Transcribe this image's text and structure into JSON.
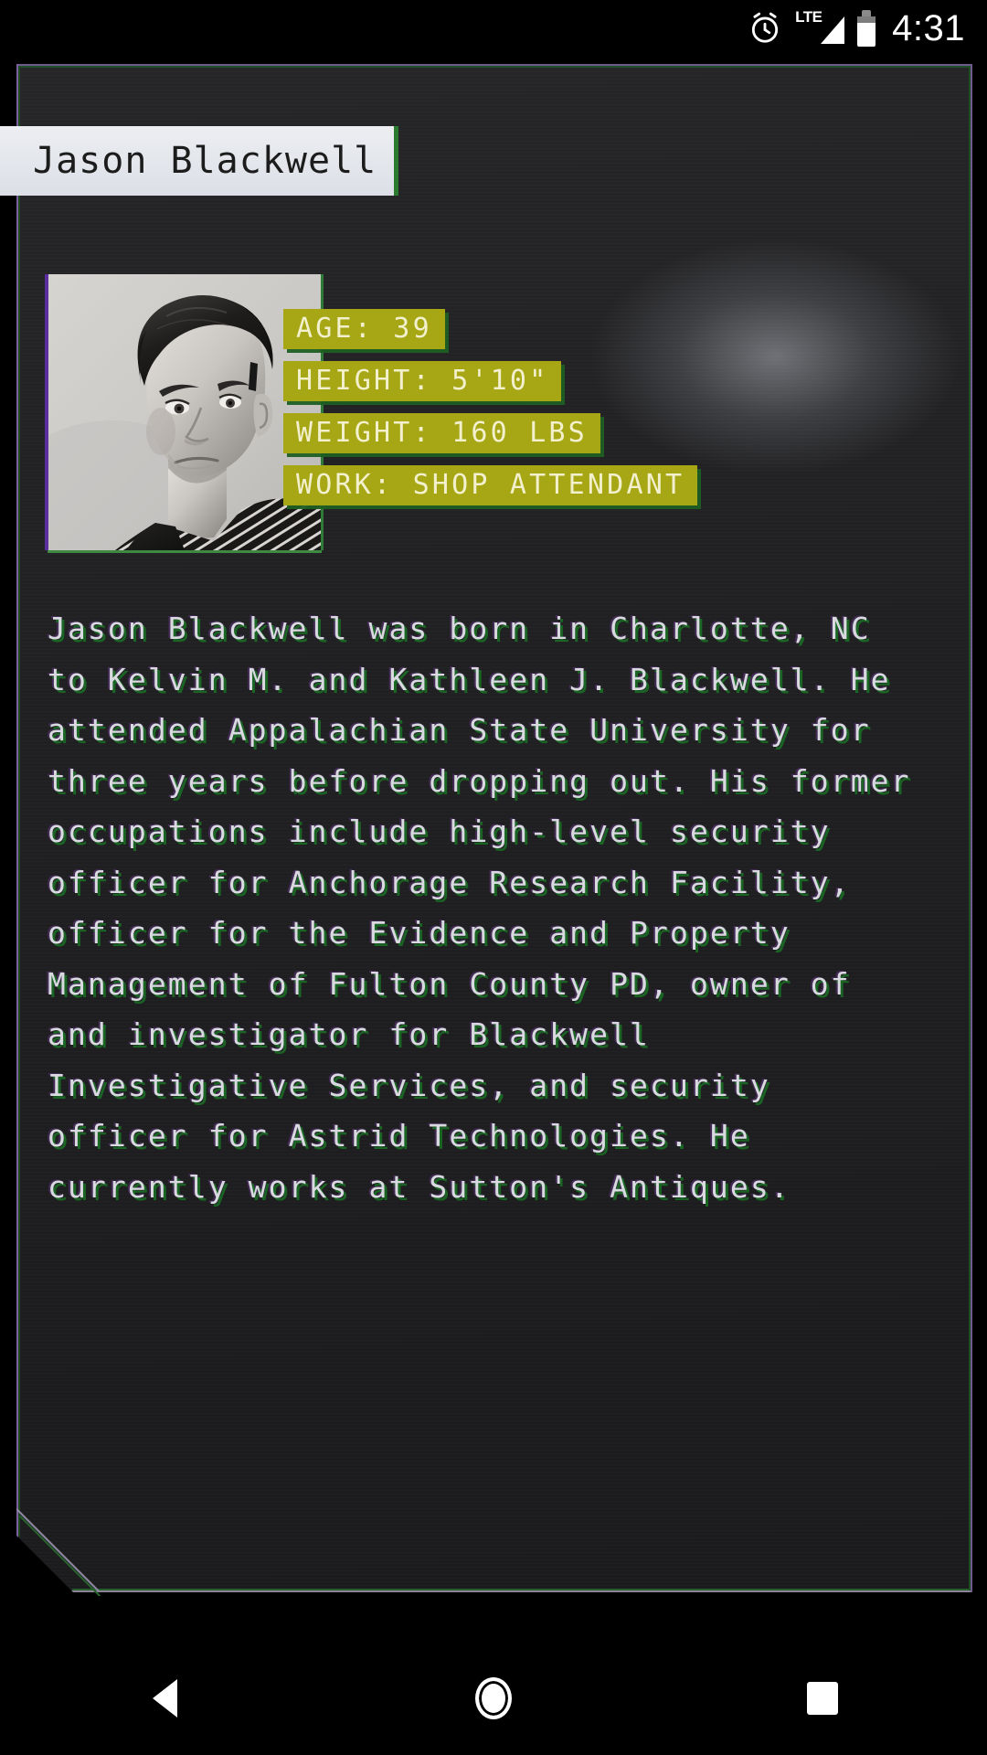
{
  "statusbar": {
    "alarm_icon": "alarm-clock-icon",
    "network_label": "LTE",
    "signal_icon": "signal-triangle-icon",
    "battery_icon": "battery-icon",
    "time": "4:31"
  },
  "card": {
    "title": "Jason Blackwell",
    "portrait_alt": "black-and-white portrait of a man with dark hair in a pinstripe shirt",
    "stats": [
      {
        "label": "AGE:",
        "value": "39",
        "text": "AGE:  39"
      },
      {
        "label": "HEIGHT:",
        "value": "5'10\"",
        "text": "HEIGHT:  5'10\""
      },
      {
        "label": "WEIGHT:",
        "value": "160 LBS",
        "text": "WEIGHT:  160 LBS"
      },
      {
        "label": "WORK:",
        "value": "SHOP ATTENDANT",
        "text": "WORK:  SHOP ATTENDANT"
      }
    ],
    "bio": "Jason Blackwell was born in Charlotte, NC to Kelvin M. and Kathleen J. Blackwell. He attended Appalachian State University for three years before dropping out. His former occupations include high-level security officer for Anchorage Research Facility, officer for the Evidence and Property Management of Fulton County PD, owner of and investigator for Blackwell Investigative Services, and security officer for Astrid Technologies. He currently works at Sutton's Antiques."
  },
  "navbar": {
    "back": "back-button",
    "home": "home-button",
    "recents": "recents-button"
  },
  "colors": {
    "tag_background": "#a7a614",
    "tag_text": "#f2f0cd",
    "tag_shadow_green": "#1e5f23",
    "accent_green": "#2a7a2f",
    "accent_purple": "#5b2d9e",
    "title_banner": "#e4e7ec",
    "body_text": "#d8dadf",
    "card_background": "#222224"
  }
}
